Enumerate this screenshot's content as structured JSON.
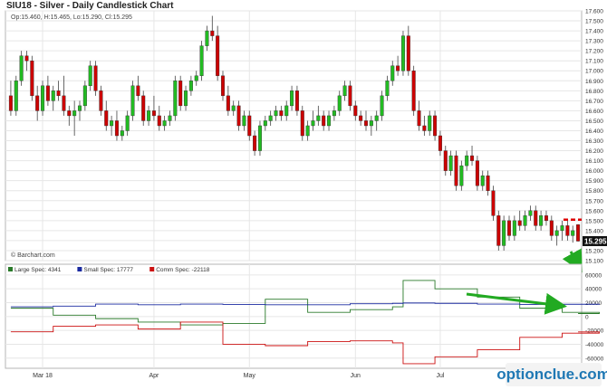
{
  "chart_data": [
    {
      "type": "candlestick",
      "title": "SIU18 - Silver - Daily Candlestick Chart",
      "ohlc_label": "Op:15.460, H:15.465, Lo:15.290, Cl:15.295",
      "source": "© Barchart.com",
      "ylim": [
        15.1,
        17.6
      ],
      "yticks": [
        15.1,
        15.2,
        15.3,
        15.4,
        15.5,
        15.6,
        15.7,
        15.8,
        15.9,
        16.0,
        16.1,
        16.2,
        16.3,
        16.4,
        16.5,
        16.6,
        16.7,
        16.8,
        16.9,
        17.0,
        17.1,
        17.2,
        17.3,
        17.4,
        17.5,
        17.6
      ],
      "ytick_labels": [
        "15.100",
        "15.200",
        "15.300",
        "15.400",
        "15.500",
        "15.600",
        "15.700",
        "15.800",
        "15.900",
        "16.000",
        "16.100",
        "16.200",
        "16.300",
        "16.400",
        "16.500",
        "16.600",
        "16.700",
        "16.800",
        "16.900",
        "17.000",
        "17.100",
        "17.200",
        "17.300",
        "17.400",
        "17.500",
        "17.600"
      ],
      "last_price_label": "15.295",
      "last_price": 15.295,
      "dashed_level": 15.51,
      "up_color": "#22bb22",
      "down_color": "#cc0000",
      "candles": [
        [
          16.75,
          16.9,
          16.55,
          16.6
        ],
        [
          16.6,
          16.95,
          16.55,
          16.9
        ],
        [
          16.9,
          17.2,
          16.85,
          17.15
        ],
        [
          17.15,
          17.2,
          17.0,
          17.1
        ],
        [
          17.1,
          17.15,
          16.7,
          16.75
        ],
        [
          16.75,
          16.85,
          16.5,
          16.6
        ],
        [
          16.6,
          16.9,
          16.55,
          16.85
        ],
        [
          16.85,
          16.95,
          16.65,
          16.7
        ],
        [
          16.7,
          16.85,
          16.6,
          16.8
        ],
        [
          16.8,
          16.9,
          16.7,
          16.75
        ],
        [
          16.75,
          16.95,
          16.55,
          16.6
        ],
        [
          16.6,
          16.65,
          16.45,
          16.55
        ],
        [
          16.55,
          16.7,
          16.35,
          16.6
        ],
        [
          16.6,
          16.7,
          16.5,
          16.65
        ],
        [
          16.65,
          16.9,
          16.6,
          16.85
        ],
        [
          16.85,
          17.1,
          16.8,
          17.05
        ],
        [
          17.05,
          17.1,
          16.75,
          16.8
        ],
        [
          16.8,
          16.85,
          16.55,
          16.6
        ],
        [
          16.6,
          16.7,
          16.4,
          16.45
        ],
        [
          16.45,
          16.55,
          16.35,
          16.5
        ],
        [
          16.5,
          16.6,
          16.3,
          16.35
        ],
        [
          16.35,
          16.45,
          16.3,
          16.4
        ],
        [
          16.4,
          16.6,
          16.35,
          16.55
        ],
        [
          16.55,
          16.9,
          16.5,
          16.85
        ],
        [
          16.85,
          16.95,
          16.7,
          16.75
        ],
        [
          16.75,
          16.8,
          16.45,
          16.5
        ],
        [
          16.5,
          16.65,
          16.45,
          16.6
        ],
        [
          16.6,
          16.75,
          16.5,
          16.55
        ],
        [
          16.55,
          16.65,
          16.4,
          16.45
        ],
        [
          16.45,
          16.55,
          16.4,
          16.5
        ],
        [
          16.5,
          16.6,
          16.45,
          16.55
        ],
        [
          16.55,
          16.95,
          16.5,
          16.9
        ],
        [
          16.9,
          16.95,
          16.6,
          16.65
        ],
        [
          16.65,
          16.85,
          16.6,
          16.8
        ],
        [
          16.8,
          16.95,
          16.75,
          16.9
        ],
        [
          16.9,
          17.0,
          16.85,
          16.95
        ],
        [
          16.95,
          17.3,
          16.9,
          17.25
        ],
        [
          17.25,
          17.45,
          17.2,
          17.4
        ],
        [
          17.4,
          17.55,
          17.3,
          17.35
        ],
        [
          17.35,
          17.45,
          16.9,
          16.95
        ],
        [
          16.95,
          17.0,
          16.7,
          16.75
        ],
        [
          16.75,
          16.85,
          16.55,
          16.6
        ],
        [
          16.6,
          16.7,
          16.55,
          16.65
        ],
        [
          16.65,
          16.7,
          16.4,
          16.45
        ],
        [
          16.45,
          16.6,
          16.4,
          16.55
        ],
        [
          16.55,
          16.6,
          16.3,
          16.35
        ],
        [
          16.35,
          16.4,
          16.15,
          16.2
        ],
        [
          16.2,
          16.5,
          16.15,
          16.45
        ],
        [
          16.45,
          16.55,
          16.4,
          16.5
        ],
        [
          16.5,
          16.6,
          16.45,
          16.55
        ],
        [
          16.55,
          16.65,
          16.5,
          16.6
        ],
        [
          16.6,
          16.65,
          16.5,
          16.55
        ],
        [
          16.55,
          16.7,
          16.5,
          16.65
        ],
        [
          16.65,
          16.85,
          16.6,
          16.8
        ],
        [
          16.8,
          16.85,
          16.55,
          16.6
        ],
        [
          16.6,
          16.65,
          16.3,
          16.35
        ],
        [
          16.35,
          16.5,
          16.3,
          16.45
        ],
        [
          16.45,
          16.6,
          16.4,
          16.5
        ],
        [
          16.5,
          16.65,
          16.45,
          16.55
        ],
        [
          16.55,
          16.6,
          16.4,
          16.45
        ],
        [
          16.45,
          16.6,
          16.4,
          16.55
        ],
        [
          16.55,
          16.65,
          16.5,
          16.6
        ],
        [
          16.6,
          16.8,
          16.55,
          16.75
        ],
        [
          16.75,
          16.9,
          16.7,
          16.85
        ],
        [
          16.85,
          16.9,
          16.6,
          16.65
        ],
        [
          16.65,
          16.7,
          16.5,
          16.55
        ],
        [
          16.55,
          16.6,
          16.45,
          16.5
        ],
        [
          16.5,
          16.6,
          16.4,
          16.45
        ],
        [
          16.45,
          16.55,
          16.35,
          16.5
        ],
        [
          16.5,
          16.6,
          16.4,
          16.55
        ],
        [
          16.55,
          16.8,
          16.5,
          16.75
        ],
        [
          16.75,
          16.95,
          16.7,
          16.9
        ],
        [
          16.9,
          17.1,
          16.85,
          17.05
        ],
        [
          17.05,
          17.15,
          16.95,
          17.0
        ],
        [
          17.0,
          17.4,
          16.95,
          17.35
        ],
        [
          17.35,
          17.45,
          16.95,
          17.0
        ],
        [
          17.0,
          17.05,
          16.55,
          16.6
        ],
        [
          16.6,
          16.7,
          16.4,
          16.45
        ],
        [
          16.45,
          16.55,
          16.35,
          16.4
        ],
        [
          16.4,
          16.6,
          16.35,
          16.55
        ],
        [
          16.55,
          16.6,
          16.3,
          16.35
        ],
        [
          16.35,
          16.4,
          16.15,
          16.2
        ],
        [
          16.2,
          16.25,
          15.95,
          16.0
        ],
        [
          16.0,
          16.2,
          15.95,
          16.15
        ],
        [
          16.15,
          16.2,
          15.8,
          15.85
        ],
        [
          15.85,
          16.1,
          15.8,
          16.05
        ],
        [
          16.05,
          16.2,
          16.0,
          16.15
        ],
        [
          16.15,
          16.25,
          16.05,
          16.1
        ],
        [
          16.1,
          16.15,
          15.8,
          15.85
        ],
        [
          15.85,
          16.0,
          15.8,
          15.95
        ],
        [
          15.95,
          16.0,
          15.75,
          15.8
        ],
        [
          15.8,
          15.85,
          15.5,
          15.55
        ],
        [
          15.55,
          15.6,
          15.2,
          15.25
        ],
        [
          15.25,
          15.55,
          15.2,
          15.5
        ],
        [
          15.5,
          15.55,
          15.3,
          15.35
        ],
        [
          15.35,
          15.55,
          15.3,
          15.5
        ],
        [
          15.5,
          15.6,
          15.4,
          15.45
        ],
        [
          15.45,
          15.6,
          15.4,
          15.55
        ],
        [
          15.55,
          15.65,
          15.5,
          15.6
        ],
        [
          15.6,
          15.65,
          15.4,
          15.45
        ],
        [
          15.45,
          15.6,
          15.4,
          15.55
        ],
        [
          15.55,
          15.6,
          15.45,
          15.5
        ],
        [
          15.5,
          15.55,
          15.3,
          15.35
        ],
        [
          15.35,
          15.45,
          15.25,
          15.4
        ],
        [
          15.4,
          15.5,
          15.3,
          15.45
        ],
        [
          15.45,
          15.5,
          15.3,
          15.35
        ],
        [
          15.35,
          15.45,
          15.28,
          15.4
        ],
        [
          15.46,
          15.465,
          15.29,
          15.295
        ]
      ]
    },
    {
      "type": "line",
      "yticks": [
        60000,
        40000,
        20000,
        0,
        -20000,
        -40000,
        -60000
      ],
      "ytick_labels": [
        "60000",
        "40000",
        "20000",
        "0",
        "-20000",
        "-40000",
        "-60000"
      ],
      "ylim": [
        -72000,
        65000
      ],
      "x": [
        0,
        8,
        16,
        24,
        32,
        40,
        48,
        56,
        64,
        72,
        74,
        80,
        88,
        96,
        104,
        111
      ],
      "series": [
        {
          "name": "Large Spec: 4341",
          "color": "#2a7a2a",
          "values": [
            12000,
            2000,
            -3000,
            -8000,
            -12000,
            -10000,
            25000,
            6000,
            10000,
            14000,
            52000,
            40000,
            28000,
            12000,
            6000,
            4341
          ]
        },
        {
          "name": "Small Spec: 17777",
          "color": "#1a2aa0",
          "values": [
            14000,
            15000,
            18000,
            17000,
            18000,
            17500,
            17000,
            17000,
            18500,
            19000,
            19500,
            19000,
            18000,
            17500,
            17700,
            17777
          ]
        },
        {
          "name": "Comm Spec: -22118",
          "color": "#cc1111",
          "values": [
            -22000,
            -14000,
            -12000,
            -18000,
            -8000,
            -40000,
            -42000,
            -36000,
            -35000,
            -38000,
            -68000,
            -58000,
            -48000,
            -30000,
            -24000,
            -22118
          ]
        }
      ],
      "x_tick_labels": [
        "Mar 18",
        "Apr",
        "May",
        "Jun",
        "Jul"
      ],
      "x_tick_positions": [
        6,
        27,
        45,
        65,
        81
      ]
    }
  ],
  "watermark": "optionclue.com"
}
